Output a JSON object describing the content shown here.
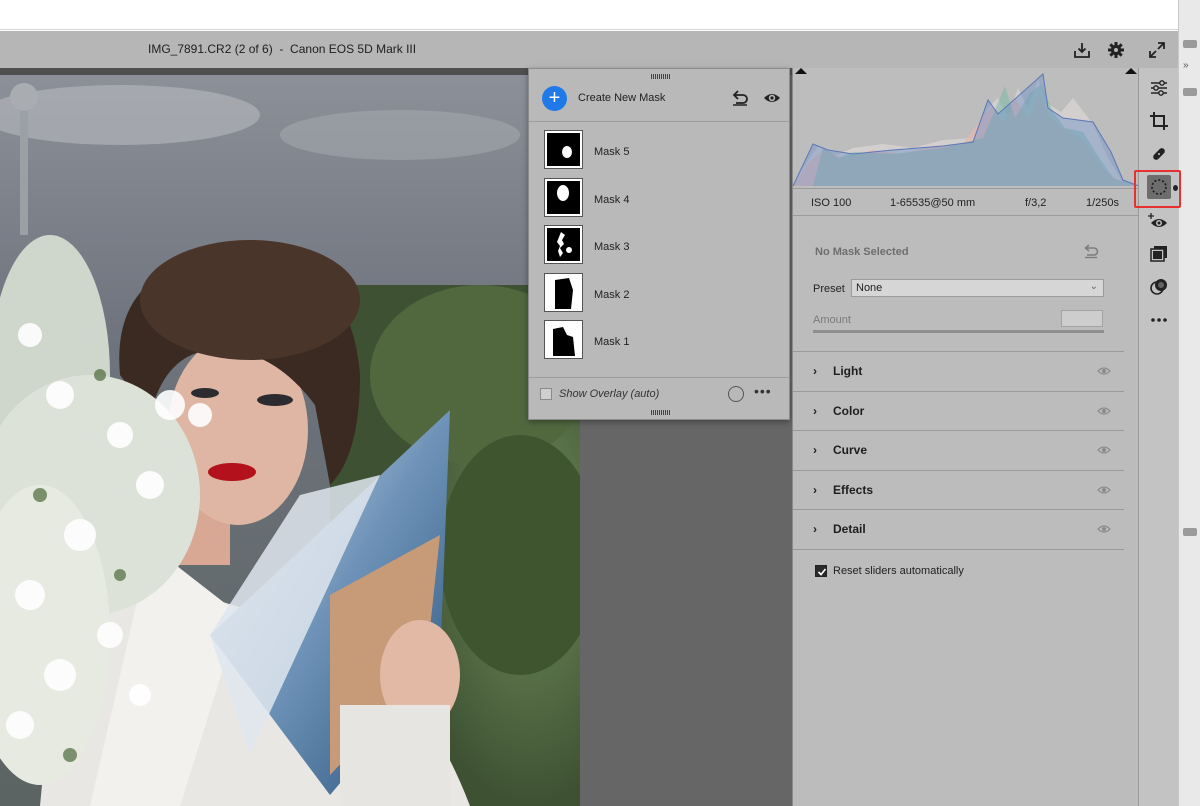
{
  "window": {
    "title": "IMG_7891.CR2 (2 of 6)  -  Canon EOS 5D Mark III"
  },
  "titlebar_icons": [
    "save-download-icon",
    "gear-icon",
    "expand-icon"
  ],
  "mask_panel": {
    "create_label": "Create New Mask",
    "masks": [
      {
        "label": "Mask 5"
      },
      {
        "label": "Mask 4"
      },
      {
        "label": "Mask 3"
      },
      {
        "label": "Mask 2"
      },
      {
        "label": "Mask 1"
      }
    ],
    "overlay_label": "Show Overlay (auto)",
    "overlay_checked": false,
    "accent": "#1f7ae8"
  },
  "camera_info": {
    "iso": "ISO 100",
    "lens": "1-65535@50 mm",
    "aperture": "f/3,2",
    "shutter": "1/250s"
  },
  "mask_settings": {
    "no_mask": "No Mask Selected",
    "preset_label": "Preset",
    "preset_value": "None",
    "amount_label": "Amount"
  },
  "sections": [
    {
      "label": "Light"
    },
    {
      "label": "Color"
    },
    {
      "label": "Curve"
    },
    {
      "label": "Effects"
    },
    {
      "label": "Detail"
    }
  ],
  "reset_sliders": {
    "label": "Reset sliders automatically",
    "checked": true
  },
  "tools": [
    "edit-sliders-icon",
    "crop-icon",
    "healing-icon",
    "masking-icon",
    "red-eye-icon",
    "presets-icon",
    "snapshots-icon",
    "more-icon"
  ],
  "highlight_color": "#e83030"
}
